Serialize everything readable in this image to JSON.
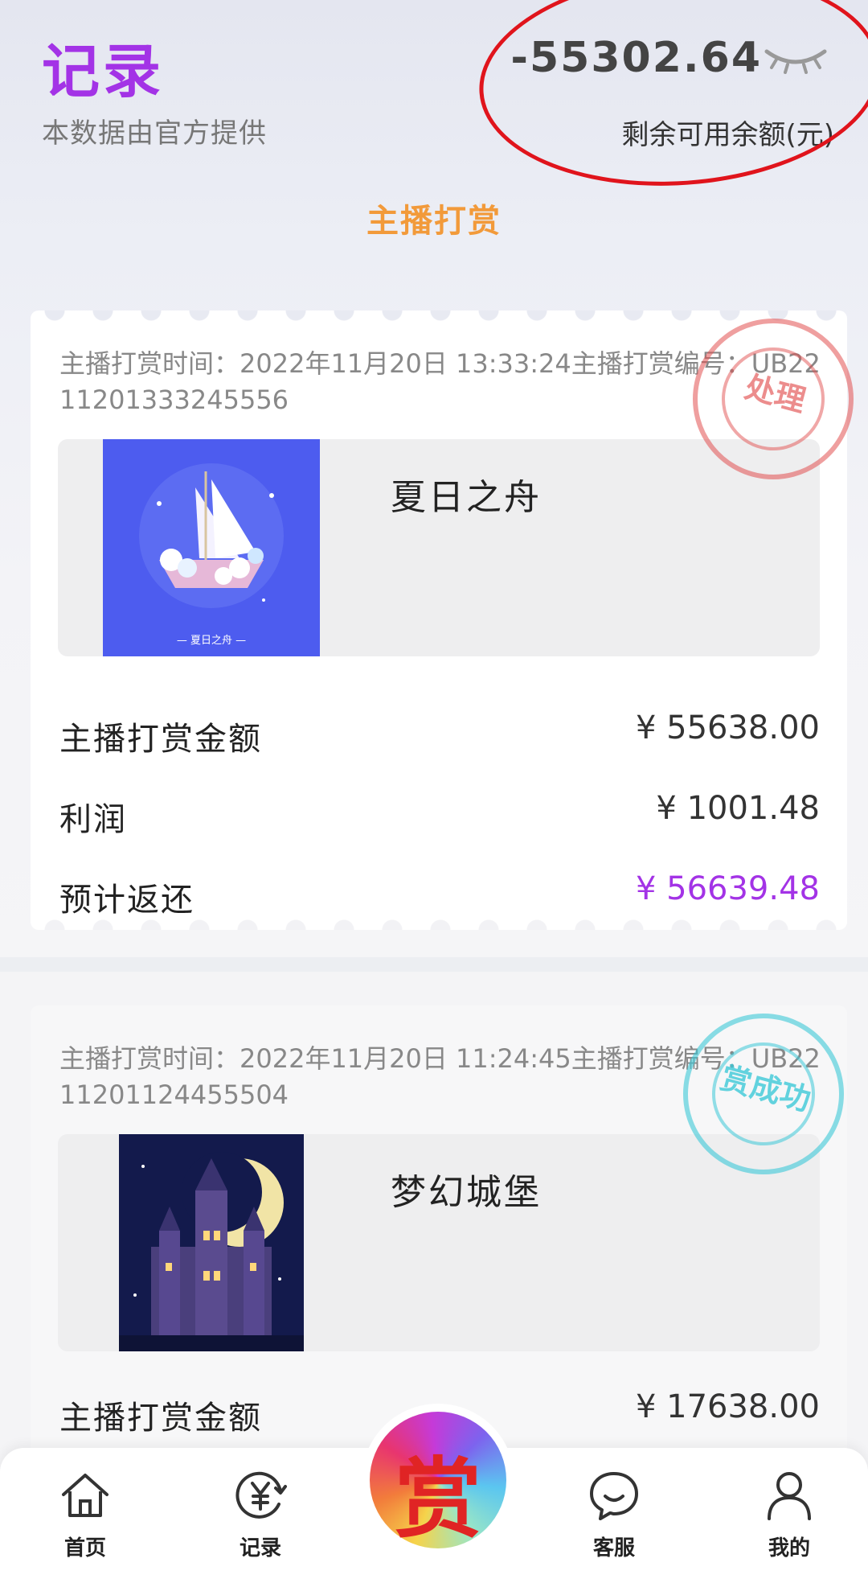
{
  "header": {
    "title": "记录",
    "subtitle": "本数据由官方提供",
    "balance": "-55302.64",
    "balance_label": "剩余可用余额(元)"
  },
  "tab": {
    "title": "主播打赏"
  },
  "records": [
    {
      "meta": "主播打赏时间：2022年11月20日 13:33:24主播打赏编号：UB2211201333245556",
      "product_name": "夏日之舟",
      "thumb_caption": "— 夏日之舟 —",
      "stamp": "处理",
      "amount_label": "主播打赏金额",
      "amount": "¥ 55638.00",
      "profit_label": "利润",
      "profit": "¥ 1001.48",
      "return_label": "预计返还",
      "return": "¥ 56639.48"
    },
    {
      "meta": "主播打赏时间：2022年11月20日 11:24:45主播打赏编号：UB2211201124455504",
      "product_name": "梦幻城堡",
      "stamp": "赏成功",
      "amount_label": "主播打赏金额",
      "amount": "¥ 17638.00"
    }
  ],
  "nav": {
    "items": [
      {
        "label": "首页",
        "icon": "home-icon"
      },
      {
        "label": "记录",
        "icon": "yuan-record-icon"
      },
      {
        "label": "客服",
        "icon": "chat-bubble-icon"
      },
      {
        "label": "我的",
        "icon": "user-icon"
      }
    ],
    "center_char": "赏"
  },
  "colors": {
    "accent_purple": "#a333e6",
    "tab_orange": "#f29a3a",
    "circle_red": "#e0141c",
    "stamp_red": "#e25050",
    "stamp_cyan": "#3cc8d7"
  }
}
